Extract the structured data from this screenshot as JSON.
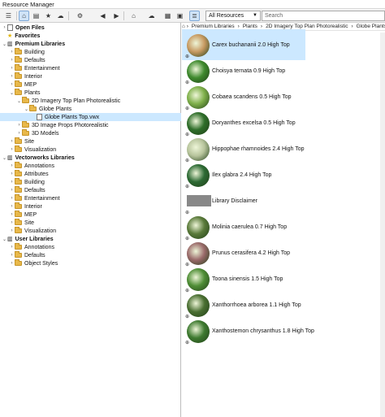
{
  "window": {
    "title": "Resource Manager"
  },
  "toolbar": {
    "filter_select": "All Resources",
    "search_placeholder": "Search"
  },
  "tree": {
    "rows": [
      {
        "label": "Open Files",
        "indent": 0,
        "kind": "file",
        "bold": true,
        "chev": "›"
      },
      {
        "label": "Favorites",
        "indent": 0,
        "kind": "star",
        "bold": true,
        "chev": ""
      },
      {
        "label": "Premium Libraries",
        "indent": 0,
        "kind": "lib",
        "bold": true,
        "chev": "⌄"
      },
      {
        "label": "Building",
        "indent": 1,
        "kind": "folder",
        "chev": "›"
      },
      {
        "label": "Defaults",
        "indent": 1,
        "kind": "folder",
        "chev": "›"
      },
      {
        "label": "Entertainment",
        "indent": 1,
        "kind": "folder",
        "chev": "›"
      },
      {
        "label": "Interior",
        "indent": 1,
        "kind": "folder",
        "chev": "›"
      },
      {
        "label": "MEP",
        "indent": 1,
        "kind": "folder",
        "chev": "›"
      },
      {
        "label": "Plants",
        "indent": 1,
        "kind": "folder",
        "chev": "⌄"
      },
      {
        "label": "2D Imagery Top Plan Photorealistic",
        "indent": 2,
        "kind": "folder",
        "chev": "⌄"
      },
      {
        "label": "Globe Plants",
        "indent": 3,
        "kind": "folder",
        "chev": "⌄"
      },
      {
        "label": "Globe Plants Top.vwx",
        "indent": 4,
        "kind": "file",
        "chev": "",
        "selected": true
      },
      {
        "label": "3D Image Props Photorealistic",
        "indent": 2,
        "kind": "folder",
        "chev": "›"
      },
      {
        "label": "3D Models",
        "indent": 2,
        "kind": "folder",
        "chev": "›"
      },
      {
        "label": "Site",
        "indent": 1,
        "kind": "folder",
        "chev": "›"
      },
      {
        "label": "Visualization",
        "indent": 1,
        "kind": "folder",
        "chev": "›"
      },
      {
        "label": "Vectorworks Libraries",
        "indent": 0,
        "kind": "lib",
        "bold": true,
        "chev": "⌄"
      },
      {
        "label": "Annotations",
        "indent": 1,
        "kind": "folder",
        "chev": "›"
      },
      {
        "label": "Attributes",
        "indent": 1,
        "kind": "folder",
        "chev": "›"
      },
      {
        "label": "Building",
        "indent": 1,
        "kind": "folder",
        "chev": "›"
      },
      {
        "label": "Defaults",
        "indent": 1,
        "kind": "folder",
        "chev": "›"
      },
      {
        "label": "Entertainment",
        "indent": 1,
        "kind": "folder",
        "chev": "›"
      },
      {
        "label": "Interior",
        "indent": 1,
        "kind": "folder",
        "chev": "›"
      },
      {
        "label": "MEP",
        "indent": 1,
        "kind": "folder",
        "chev": "›"
      },
      {
        "label": "Site",
        "indent": 1,
        "kind": "folder",
        "chev": "›"
      },
      {
        "label": "Visualization",
        "indent": 1,
        "kind": "folder",
        "chev": "›"
      },
      {
        "label": "User Libraries",
        "indent": 0,
        "kind": "lib",
        "bold": true,
        "chev": "⌄"
      },
      {
        "label": "Annotations",
        "indent": 1,
        "kind": "folder",
        "chev": "›"
      },
      {
        "label": "Defaults",
        "indent": 1,
        "kind": "folder",
        "chev": "›"
      },
      {
        "label": "Object Styles",
        "indent": 1,
        "kind": "folder",
        "chev": "›"
      }
    ]
  },
  "breadcrumb": [
    "Premium Libraries",
    "Plants",
    "2D Imagery Top Plan Photorealistic",
    "Globe Plants",
    "Glo"
  ],
  "resources": [
    {
      "label": "Carex buchananii 2.0 High Top",
      "color": "#c79a62",
      "selected": true
    },
    {
      "label": "Choisya ternata 0.9 High Top",
      "color": "#3f8a2e"
    },
    {
      "label": "Cobaea scandens 0.5 High Top",
      "color": "#7fb04a"
    },
    {
      "label": "Doryanthes excelsa 0.5 High Top",
      "color": "#2f6e2a"
    },
    {
      "label": "Hippophae rhamnoides 2.4 High Top",
      "color": "#b7c49c"
    },
    {
      "label": "Ilex glabra 2.4 High Top",
      "color": "#2d6a34"
    },
    {
      "label": "Library Disclaimer",
      "color": "#888888",
      "gray": true
    },
    {
      "label": "Molinia caerulea 0.7 High Top",
      "color": "#5a7a3a"
    },
    {
      "label": "Prunus cerasifera 4.2 High Top",
      "color": "#9a6a6a"
    },
    {
      "label": "Toona sinensis 1.5 High Top",
      "color": "#4f8e36"
    },
    {
      "label": "Xanthorrhoea arborea 1.1 High Top",
      "color": "#4a6f32"
    },
    {
      "label": "Xanthostemon chrysanthus 1.8 High Top",
      "color": "#3e7a30"
    }
  ]
}
